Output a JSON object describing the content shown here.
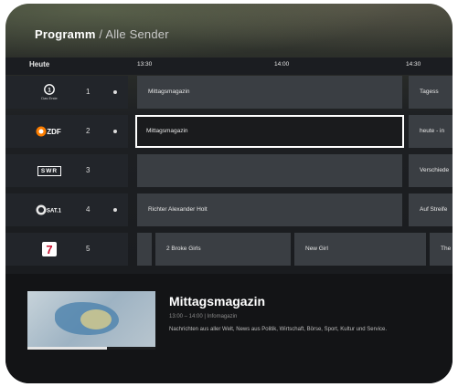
{
  "header": {
    "title": "Programm",
    "separator": " / ",
    "subtitle": "Alle Sender"
  },
  "timebar": {
    "today": "Heute",
    "times": [
      "13:30",
      "14:00",
      "14:30"
    ]
  },
  "channels": [
    {
      "num": "1",
      "logo": "ARD",
      "logo_sub": "Das Erste",
      "live": true
    },
    {
      "num": "2",
      "logo": "ZDF",
      "live": true
    },
    {
      "num": "3",
      "logo": "SWR",
      "live": false
    },
    {
      "num": "4",
      "logo": "SAT.1",
      "live": true
    },
    {
      "num": "5",
      "logo": "7",
      "live": false
    }
  ],
  "programs": {
    "row1": [
      "Mittagsmagazin",
      "Tagess"
    ],
    "row2": [
      "Mittagsmagazin",
      "heute - in"
    ],
    "row3": [
      "Verschiede"
    ],
    "row4": [
      "Richter Alexander Holt",
      "Auf Streife"
    ],
    "row5": [
      "2 Broke Girls",
      "New Girl",
      "The S"
    ]
  },
  "info": {
    "title": "Mittagsmagazin",
    "time": "13:00 – 14:00 | Infomagazin",
    "description": "Nachrichten aus aller Welt, News aus Politik, Wirtschaft, Börse, Sport, Kultur und Service.",
    "progress": 0.62
  },
  "colors": {
    "accent": "#ffffff",
    "zdf": "#fb7d00"
  }
}
